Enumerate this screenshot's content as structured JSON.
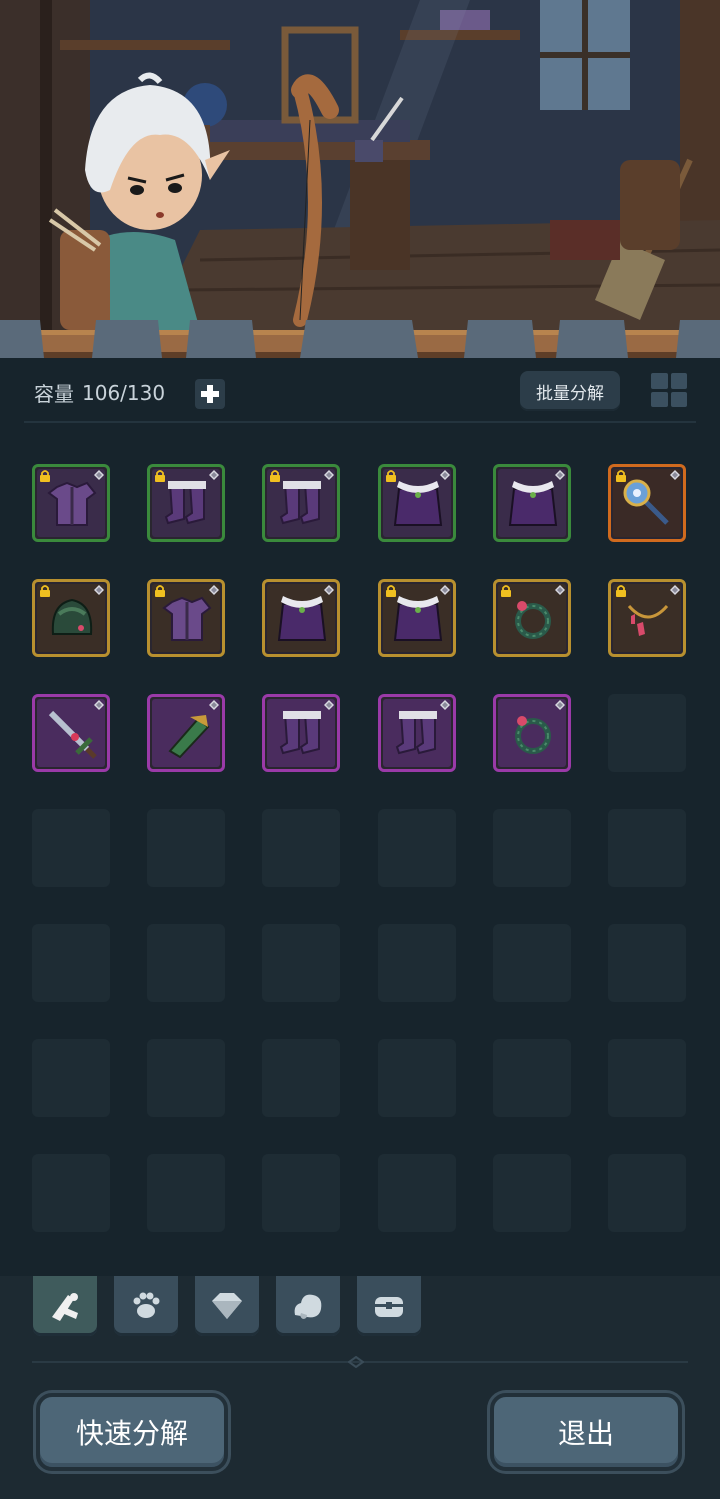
{
  "header": {
    "capacity_label": "容量",
    "capacity_value": "106/130",
    "add_icon": "plus-icon",
    "batch_label": "批量分解",
    "view_toggle_icon": "grid-view-icon"
  },
  "colors": {
    "rarity_green": "#3a8a3c",
    "rarity_gold": "#b8902f",
    "rarity_orange": "#d06a1e",
    "rarity_purple": "#9a3aa8",
    "panel_bg": "#17242c"
  },
  "inventory": {
    "capacity_used": 106,
    "capacity_total": 130,
    "items": [
      {
        "icon": "armor-icon",
        "rarity": "green",
        "locked": true
      },
      {
        "icon": "boots-icon",
        "rarity": "green",
        "locked": true
      },
      {
        "icon": "boots-icon",
        "rarity": "green",
        "locked": true
      },
      {
        "icon": "cloak-icon",
        "rarity": "green",
        "locked": true
      },
      {
        "icon": "cloak-icon",
        "rarity": "green",
        "locked": false
      },
      {
        "icon": "staff-icon",
        "rarity": "orange",
        "locked": true
      },
      {
        "icon": "helmet-icon",
        "rarity": "gold",
        "locked": true
      },
      {
        "icon": "armor-icon",
        "rarity": "gold",
        "locked": true
      },
      {
        "icon": "cloak-icon",
        "rarity": "gold",
        "locked": false
      },
      {
        "icon": "cloak-icon",
        "rarity": "gold",
        "locked": true
      },
      {
        "icon": "ring-icon",
        "rarity": "gold",
        "locked": true
      },
      {
        "icon": "necklace-icon",
        "rarity": "gold",
        "locked": true
      },
      {
        "icon": "sword-icon",
        "rarity": "purple",
        "locked": false
      },
      {
        "icon": "bracer-icon",
        "rarity": "purple",
        "locked": false
      },
      {
        "icon": "boots-icon",
        "rarity": "purple",
        "locked": false
      },
      {
        "icon": "boots-icon",
        "rarity": "purple",
        "locked": false
      },
      {
        "icon": "ring-icon",
        "rarity": "purple",
        "locked": false
      }
    ]
  },
  "tabs": [
    {
      "icon": "weapon-tab-icon",
      "active": true
    },
    {
      "icon": "paw-tab-icon",
      "active": false
    },
    {
      "icon": "gem-tab-icon",
      "active": false
    },
    {
      "icon": "stone-tab-icon",
      "active": false
    },
    {
      "icon": "chest-tab-icon",
      "active": false
    }
  ],
  "footer": {
    "quick_decompose_label": "快速分解",
    "exit_label": "退出"
  }
}
